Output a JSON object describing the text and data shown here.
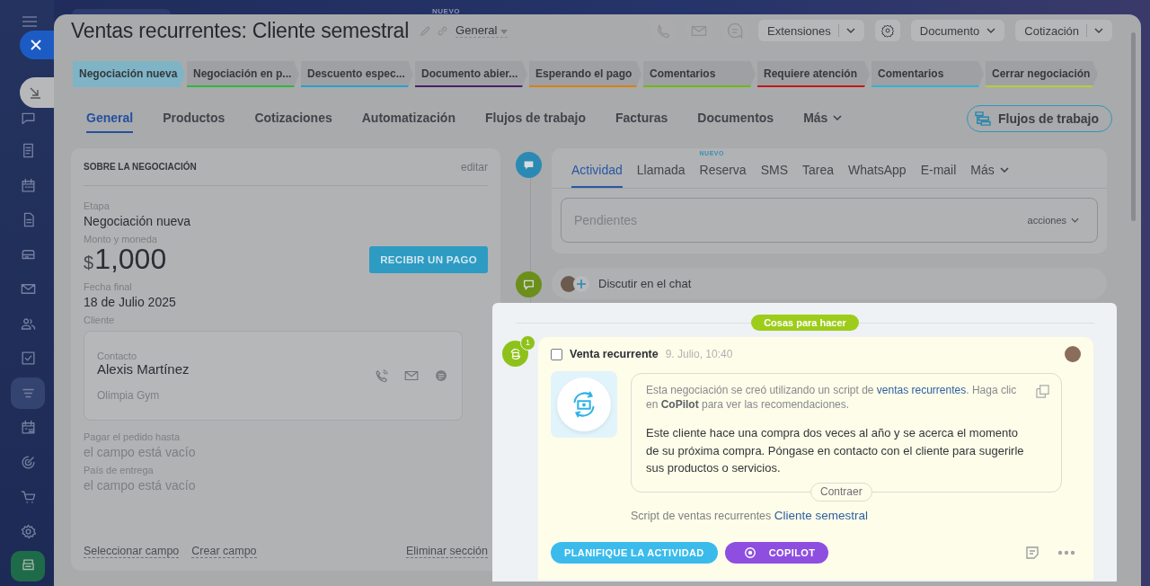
{
  "sidebar": {
    "new_badge": "NUEVO",
    "items": [
      {
        "selected": false
      },
      {
        "selected": false
      },
      {
        "selected": false
      },
      {
        "selected": false
      },
      {
        "selected": false
      },
      {
        "selected": false
      },
      {
        "selected": false
      },
      {
        "selected": false
      },
      {
        "selected": true
      },
      {
        "selected": false
      },
      {
        "selected": false
      },
      {
        "selected": false
      },
      {
        "selected": false
      }
    ]
  },
  "header": {
    "title": "Ventas recurrentes: Cliente semestral",
    "pipeline": "General",
    "buttons": [
      {
        "label": "Extensiones",
        "kind": "split"
      },
      {
        "kind": "settings"
      },
      {
        "label": "Documento",
        "kind": "dropdown"
      },
      {
        "label": "Cotización",
        "kind": "split"
      }
    ]
  },
  "stages": [
    {
      "label": "Negociación nueva",
      "color": "#7fb4c6",
      "selected": true
    },
    {
      "label": "Negociación en p...",
      "color": "#2fb83a",
      "selected": false
    },
    {
      "label": "Descuento espec...",
      "color": "#2a9fd0",
      "selected": false
    },
    {
      "label": "Documento abier...",
      "color": "#4a1d6b",
      "selected": false
    },
    {
      "label": "Esperando el pago",
      "color": "#d6820f",
      "selected": false
    },
    {
      "label": "Comentarios",
      "color": "#6cba12",
      "selected": false
    },
    {
      "label": "Requiere atención",
      "color": "#c41818",
      "selected": false
    },
    {
      "label": "Comentarios",
      "color": "#33b2d2",
      "selected": false
    },
    {
      "label": "Cerrar negociación",
      "color": "#b1cf3a",
      "selected": false
    }
  ],
  "tabs": [
    {
      "label": "General",
      "selected": true
    },
    {
      "label": "Productos",
      "selected": false
    },
    {
      "label": "Cotizaciones",
      "selected": false
    },
    {
      "label": "Automatización",
      "selected": false
    },
    {
      "label": "Flujos de trabajo",
      "selected": false
    },
    {
      "label": "Facturas",
      "selected": false
    },
    {
      "label": "Documentos",
      "selected": false
    },
    {
      "label": "Más",
      "selected": false
    }
  ],
  "workflow_button": "Flujos de trabajo",
  "about": {
    "title": "SOBRE LA NEGOCIACIÓN",
    "edit": "editar",
    "fields": [
      {
        "kind": "text",
        "label": "Etapa",
        "value": "Negociación nueva"
      },
      {
        "kind": "money",
        "label": "Monto y moneda",
        "currency": "$",
        "value": "1,000",
        "button": "RECIBIR UN PAGO"
      },
      {
        "kind": "text",
        "label": "Fecha final",
        "value": "18 de Julio 2025"
      },
      {
        "kind": "client",
        "label": "Cliente",
        "contact_label": "Contacto",
        "value": "Alexis Martínez",
        "company": "Olimpia Gym"
      },
      {
        "kind": "empty",
        "label": "Pagar el pedido hasta",
        "value": "el campo está vacío"
      },
      {
        "kind": "empty",
        "label": "País de entrega",
        "value": "el campo está vacío"
      }
    ],
    "links": [
      "Seleccionar campo",
      "Crear campo"
    ],
    "delete": "Eliminar sección"
  },
  "activity": {
    "tabs": [
      {
        "label": "Actividad",
        "selected": true
      },
      {
        "label": "Llamada",
        "selected": false
      },
      {
        "label": "Reserva",
        "selected": false,
        "badge": "NUEVO"
      },
      {
        "label": "SMS",
        "selected": false
      },
      {
        "label": "Tarea",
        "selected": false
      },
      {
        "label": "WhatsApp",
        "selected": false
      },
      {
        "label": "E-mail",
        "selected": false
      },
      {
        "label": "Más",
        "selected": false
      }
    ],
    "placeholder": "Pendientes",
    "actions": "acciones",
    "chat": "Discutir en el chat"
  },
  "todo": {
    "section": "Cosas para hacer",
    "count": "1",
    "item": {
      "checked": false,
      "title": "Venta recurrente",
      "time": "9. Julio, 10:40",
      "intro_before": "Esta negociación se creó utilizando un script de",
      "intro_link": "ventas recurrentes",
      "intro_after": ". Haga clic en **CoPilot** para ver las recomendaciones.",
      "message": "Este cliente hace una compra dos veces al año y se acerca el momento de su próxima compra. Póngase en contacto con el cliente para sugerirle sus productos o servicios.",
      "collapse": "Contraer",
      "script_label": "Script de ventas recurrentes",
      "script_link": "Cliente semestral",
      "plan_button": "PLANIFIQUE LA ACTIVIDAD",
      "copilot_button": "COPILOT"
    }
  }
}
